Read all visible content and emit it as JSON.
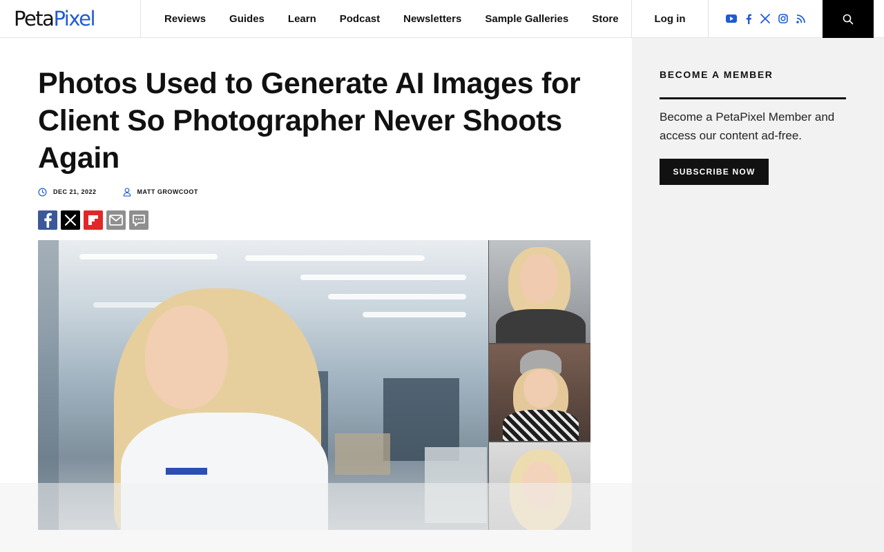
{
  "brand": {
    "logo_part1": "Peta",
    "logo_part2": "Pixel",
    "accent": "#1f5bd3"
  },
  "nav": {
    "items": [
      "Reviews",
      "Guides",
      "Learn",
      "Podcast",
      "Newsletters",
      "Sample Galleries",
      "Store"
    ],
    "login_label": "Log in"
  },
  "socials": [
    "youtube-icon",
    "facebook-icon",
    "x-icon",
    "instagram-icon",
    "rss-icon"
  ],
  "article": {
    "title": "Photos Used to Generate AI Images for Client So Photographer Never Shoots Again",
    "date": "DEC 21, 2022",
    "author": "MATT GROWCOOT",
    "share_buttons": [
      "facebook-share",
      "x-share",
      "flipboard-share",
      "email-share",
      "comments"
    ]
  },
  "sidebar": {
    "title": "BECOME A MEMBER",
    "text": "Become a PetaPixel Member and access our content ad-free.",
    "button_label": "SUBSCRIBE NOW"
  },
  "colors": {
    "header_search_bg": "#000000",
    "sidebar_bg": "#f2f2f2",
    "facebook": "#3b5998",
    "flipboard": "#e12828"
  }
}
